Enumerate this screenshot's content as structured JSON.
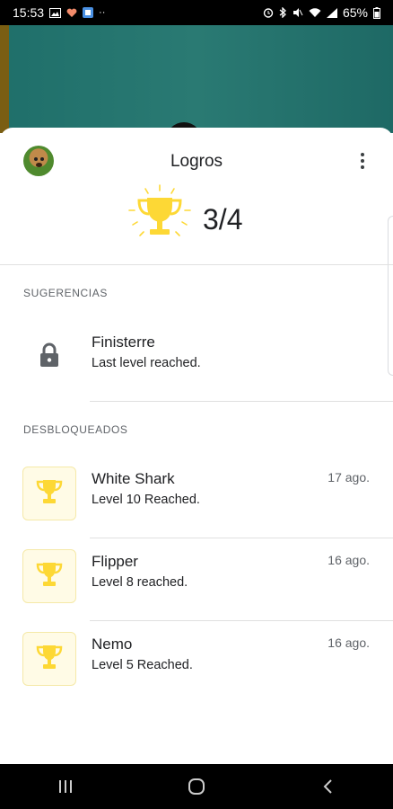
{
  "status_bar": {
    "time": "15:53",
    "battery": "65%",
    "left_icons": [
      "image-icon",
      "heart-icon",
      "app-icon",
      "more-dots-icon"
    ],
    "right_icons": [
      "alarm-icon",
      "bluetooth-icon",
      "mute-icon",
      "wifi-icon",
      "signal-icon",
      "battery-icon"
    ]
  },
  "header": {
    "title": "Logros",
    "count": "3/4"
  },
  "sections": {
    "suggestions_label": "SUGERENCIAS",
    "unlocked_label": "DESBLOQUEADOS"
  },
  "suggestions": [
    {
      "name": "Finisterre",
      "description": "Last level reached.",
      "icon": "lock-icon"
    }
  ],
  "unlocked": [
    {
      "name": "White Shark",
      "description": "Level 10 Reached.",
      "date": "17 ago.",
      "icon": "trophy-icon"
    },
    {
      "name": "Flipper",
      "description": "Level 8 reached.",
      "date": "16 ago.",
      "icon": "trophy-icon"
    },
    {
      "name": "Nemo",
      "description": "Level 5 Reached.",
      "date": "16 ago.",
      "icon": "trophy-icon"
    }
  ],
  "colors": {
    "gold": "#fdd835",
    "teal_backdrop": "#2a7a73",
    "tile_bg": "#fffbe6"
  },
  "nav": [
    "recents-icon",
    "home-icon",
    "back-icon"
  ]
}
